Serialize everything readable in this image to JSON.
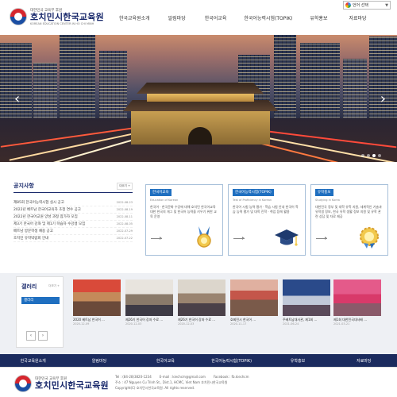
{
  "topbar": {
    "lang_label": "언어 선택"
  },
  "brand": {
    "small": "대한민국 교육부 후원",
    "name": "호치민시한국교육원",
    "sub": "KOREAN EDUCATION CENTER IN HO CHI MINH"
  },
  "nav": [
    "한국교육원소개",
    "알림마당",
    "한국어교육",
    "한국어능력시험(TOPIK)",
    "유학홍보",
    "자료마당"
  ],
  "notice": {
    "title": "공지사항",
    "more": "더보기 +",
    "items": [
      {
        "title": "제85회 한국어능력시험 실시 공고",
        "date": "2022-08-23"
      },
      {
        "title": "2022년 베트남 한국어교육자 초청 연수 공고",
        "date": "2022-08-19"
      },
      {
        "title": "2022년 한국어교원 양성 과정 참가자 모집",
        "date": "2022-08-11"
      },
      {
        "title": "제3기 한국어 강좌 및 제1기 학습자 수강생 모집",
        "date": "2022-08-05"
      },
      {
        "title": "베트남 방문학생 채용 공고",
        "date": "2022-07-29"
      },
      {
        "title": "호치민 유학박람회 안내",
        "date": "2022-07-22"
      }
    ]
  },
  "cards": [
    {
      "label": "한국어교육",
      "sub": "Education of Korean",
      "desc": "한국어 · 한국문화 수강에 대해 호치민 한국어교육 대한 한국의 게그 및 한국어 능력을 키우기 위한 교육 운영"
    },
    {
      "label": "한국어능력시험(TOPIK)",
      "sub": "Test of Proficiency in Korean",
      "desc": "한국어 시험 능력 평가 · 학습 시험 안내 한국어 학습 능력 평가 및 대학 진학 · 취업 등에 활용"
    },
    {
      "label": "유학홍보",
      "sub": "Studying in Korea",
      "desc": "대한민국 정부 및 대학 유학 지원, 세계적인 기술과 유학생 정보, 한국 유학 생활 정보 지원 및 유학 관련 상담 및 자료 제공"
    }
  ],
  "gallery": {
    "title": "갤러리",
    "more": "더보기 +",
    "button": "갤러리",
    "items": [
      {
        "caption": "2020 베트남 한국어 ...",
        "date": "2020-12-09"
      },
      {
        "caption": "제26기 한국어 강좌 수료 ...",
        "date": "2020-12-03"
      },
      {
        "caption": "제26기 한국어 강좌 수료 ...",
        "date": "2020-12-03"
      },
      {
        "caption": "호찌민시 한국어 ...",
        "date": "2020-11-17"
      },
      {
        "caption": "주베트남대사관, 제1회 ...",
        "date": "2021-06-24"
      },
      {
        "caption": "제1회 대한민국대사배 ...",
        "date": "2021-03-21"
      }
    ]
  },
  "bottom_nav": [
    "한국교육원소개",
    "알림마당",
    "한국어교육",
    "한국어능력시험(TOPIK)",
    "유학홍보",
    "자료마당"
  ],
  "footer": {
    "tel": "Tel : (84-28)3820-1234",
    "email": "E-mail : kiechcm@gmail.com",
    "facebook": "Facebook : fb.kiechcm",
    "address": "주소 : 47 Nguyen Cu Trinh St., Dist.1, HCMC, Viet Nam 호치민시한국교육원",
    "copyright": "Copyright(C) 호치민시한국교육원. All rights reserved."
  },
  "colors": {
    "navy": "#1b2b5e",
    "blue": "#1f6fc0"
  }
}
